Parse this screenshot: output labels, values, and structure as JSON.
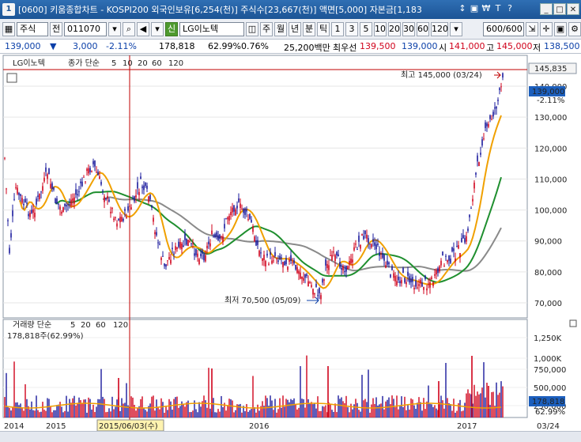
{
  "window": {
    "app_number": "1",
    "title": "[0600] 키움종합차트 - KOSPI200 외국인보유[6,254(천)] 주식수[23,667(천)] 액면[5,000] 자본금[1,183",
    "icons": [
      "↕",
      "▣",
      "₩",
      "T",
      "?",
      "▫"
    ],
    "buttons": [
      "_",
      "□",
      "✕"
    ]
  },
  "toolbar": {
    "market": "주식",
    "market_alt": "전",
    "code": "011070",
    "stock_name": "LG이노텍",
    "stock_badge": "신",
    "period_buttons": [
      "주",
      "월",
      "년",
      "분",
      "틱"
    ],
    "interval_buttons": [
      "1",
      "3",
      "5",
      "10",
      "20",
      "30",
      "60",
      "120"
    ],
    "count": "600/600"
  },
  "quote": {
    "price": "139,000",
    "change": "3,000",
    "change_pct": "-2.11%",
    "volume": "178,818",
    "volume_ratio": "62.99%",
    "turnover_pct": "0.76%",
    "amount": "25,200백만",
    "bid_label": "최우선",
    "bid": "139,500",
    "ask": "139,000",
    "open_label": "시",
    "open": "141,000",
    "high_label": "고",
    "high": "145,000",
    "low_label": "저",
    "low": "138,500"
  },
  "price_panel": {
    "legend": {
      "stock": "LG이노텍",
      "label": "종가 단순",
      "periods": [
        "5",
        "10",
        "20",
        "60",
        "120"
      ],
      "colors": [
        "#d0021b",
        "#1a1a9c",
        "#f0a000",
        "#1f8f2f",
        "#8a8a8a"
      ]
    },
    "high_annotation": "최고 145,000 (03/24)",
    "low_annotation": "최저 70,500 (05/09)",
    "current_price_tag": "139,000",
    "current_change_tag": "-2.11%",
    "high_price_tag": "145,835",
    "y_ticks": [
      "140,000",
      "130,000",
      "120,000",
      "110,000",
      "100,000",
      "90,000",
      "80,000",
      "70,000"
    ],
    "y_values": [
      140000,
      130000,
      120000,
      110000,
      100000,
      90000,
      80000,
      70000
    ]
  },
  "volume_panel": {
    "legend": {
      "label": "거래량 단순",
      "periods": [
        "5",
        "20",
        "60",
        "120"
      ]
    },
    "current_volume": "178,818주(62.99%)",
    "current_volume_tag": "178,818",
    "current_ratio_tag": "62.99%",
    "y_ticks": [
      "1,250K",
      "1,000K",
      "750,000",
      "500,000",
      "250,000"
    ]
  },
  "x_axis": {
    "labels": [
      "2014",
      "2015",
      "2015/06/03(수)",
      "2016",
      "2017"
    ],
    "right_date": "03/24"
  },
  "colors": {
    "up": "#d0021b",
    "down": "#1a1a9c",
    "ma20": "#f0a000",
    "ma60": "#1f8f2f",
    "ma120": "#8a8a8a"
  }
}
